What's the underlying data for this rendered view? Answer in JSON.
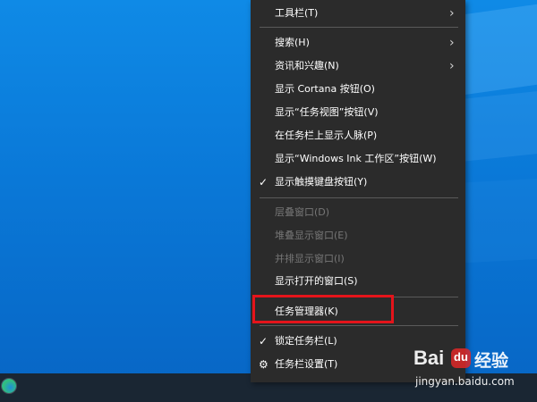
{
  "taskbar": {
    "icon": "edge-icon"
  },
  "context_menu": {
    "items": [
      {
        "label": "工具栏(T)",
        "enabled": true,
        "submenu": true
      },
      {
        "label": "搜索(H)",
        "enabled": true,
        "submenu": true
      },
      {
        "label": "资讯和兴趣(N)",
        "enabled": true,
        "submenu": true
      },
      {
        "label": "显示 Cortana 按钮(O)",
        "enabled": true
      },
      {
        "label": "显示“任务视图”按钮(V)",
        "enabled": true
      },
      {
        "label": "在任务栏上显示人脉(P)",
        "enabled": true
      },
      {
        "label": "显示“Windows Ink 工作区”按钮(W)",
        "enabled": true
      },
      {
        "label": "显示触摸键盘按钮(Y)",
        "enabled": true,
        "checked": true
      },
      {
        "label": "层叠窗口(D)",
        "enabled": false
      },
      {
        "label": "堆叠显示窗口(E)",
        "enabled": false
      },
      {
        "label": "并排显示窗口(I)",
        "enabled": false
      },
      {
        "label": "显示打开的窗口(S)",
        "enabled": true
      },
      {
        "label": "任务管理器(K)",
        "enabled": true,
        "highlighted": true
      },
      {
        "label": "锁定任务栏(L)",
        "enabled": true,
        "checked": true
      },
      {
        "label": "任务栏设置(T)",
        "enabled": true,
        "icon": "gear-icon"
      }
    ],
    "submenu_arrow": "›",
    "check_mark": "✓",
    "gear_glyph": "⚙"
  },
  "watermark": {
    "brand_bai": "Bai",
    "brand_du": "du",
    "jingyan": "经验",
    "url": "jingyan.baidu.com"
  },
  "colors": {
    "menu_bg": "#2b2b2b",
    "highlight_border": "#e4141b",
    "disabled_text": "#777777",
    "desktop_blue": "#0a78d7"
  }
}
